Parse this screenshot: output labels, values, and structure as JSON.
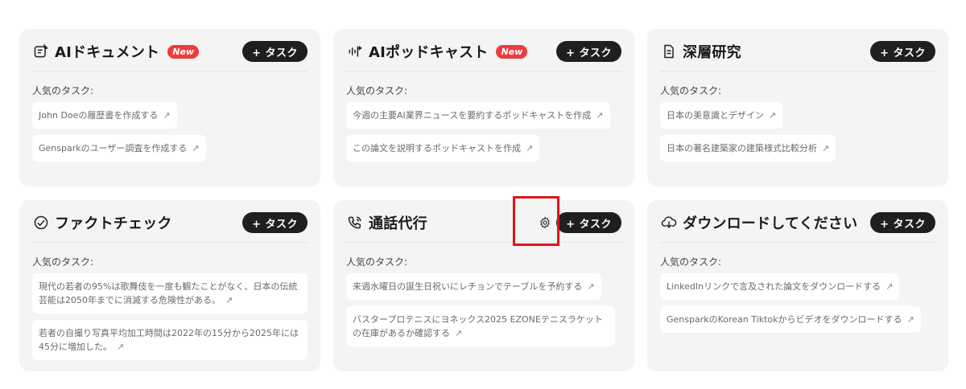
{
  "common": {
    "task_button_label": "+ タスク",
    "popular_label": "人気のタスク:",
    "new_badge": "New",
    "arrow": "↗"
  },
  "cards": [
    {
      "title": "AIドキュメント",
      "icon": "document-edit-icon",
      "has_new": true,
      "tasks": [
        "John Doeの履歴書を作成する",
        "Gensparkのユーザー調査を作成する"
      ]
    },
    {
      "title": "AIポッドキャスト",
      "icon": "sound-wave-icon",
      "has_new": true,
      "tasks": [
        "今週の主要AI業界ニュースを要約するポッドキャストを作成",
        "この論文を説明するポッドキャストを作成"
      ]
    },
    {
      "title": "深層研究",
      "icon": "file-text-icon",
      "has_new": false,
      "tasks": [
        "日本の美意識とデザイン",
        "日本の著名建築家の建築様式比較分析"
      ]
    },
    {
      "title": "ファクトチェック",
      "icon": "check-circle-icon",
      "has_new": false,
      "tasks": [
        "現代の若者の95%は歌舞伎を一度も観たことがなく、日本の伝統芸能は2050年までに消滅する危険性がある。",
        "若者の自撮り写真平均加工時間は2022年の15分から2025年には45分に増加した。"
      ]
    },
    {
      "title": "通話代行",
      "icon": "phone-call-icon",
      "has_new": false,
      "has_settings": true,
      "tasks": [
        "来週水曜日の誕生日祝いにレチョンでテーブルを予約する",
        "バスタープロテニスにヨネックス2025 EZONEテニスラケットの在庫があるか確認する"
      ]
    },
    {
      "title": "ダウンロードしてください",
      "icon": "cloud-download-icon",
      "has_new": false,
      "tasks": [
        "LinkedInリンクで言及された論文をダウンロードする",
        "GensparkのKorean Tiktokからビデオをダウンロードする"
      ]
    }
  ],
  "colors": {
    "card_bg": "#f4f4f5",
    "button_bg": "#1f1f1f",
    "new_badge_bg": "#ef3b3b",
    "highlight": "#e0141b"
  }
}
